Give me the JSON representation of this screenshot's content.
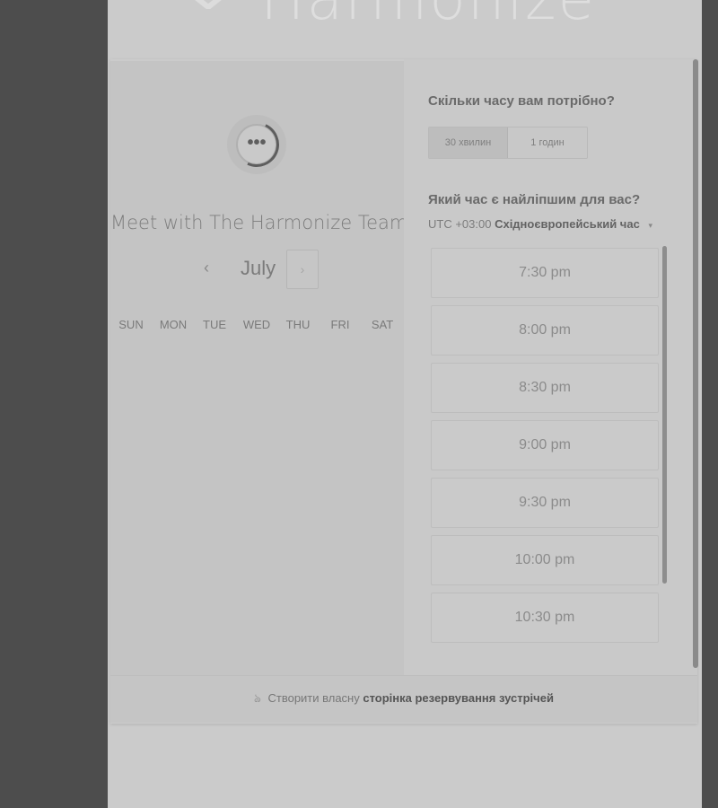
{
  "brand": {
    "logo_text": "Harmonize"
  },
  "left": {
    "avatar_glyph": "•••",
    "title": "Meet with The Harmonize Team",
    "month": "July",
    "prev_arrow": "‹",
    "next_arrow": "›",
    "weekdays": [
      "SUN",
      "MON",
      "TUE",
      "WED",
      "THU",
      "FRI",
      "SAT"
    ]
  },
  "right": {
    "duration_question": "Скільки часу вам потрібно?",
    "durations": [
      "30 хвилин",
      "1 годин"
    ],
    "time_question": "Який час є найліпшим для вас?",
    "timezone_offset": "UTC +03:00",
    "timezone_name": "Східноєвропейський час",
    "timezone_caret": "▾",
    "slots": [
      "7:30 pm",
      "8:00 pm",
      "8:30 pm",
      "9:00 pm",
      "9:30 pm",
      "10:00 pm",
      "10:30 pm"
    ]
  },
  "footer": {
    "prefix": "Створити власну",
    "link": "сторінка резервування зустрічей"
  },
  "icons": {
    "chat_bubble": "chat-bubble-icon",
    "bolt": "sprocket-icon",
    "caret": "chevron-down-icon"
  }
}
